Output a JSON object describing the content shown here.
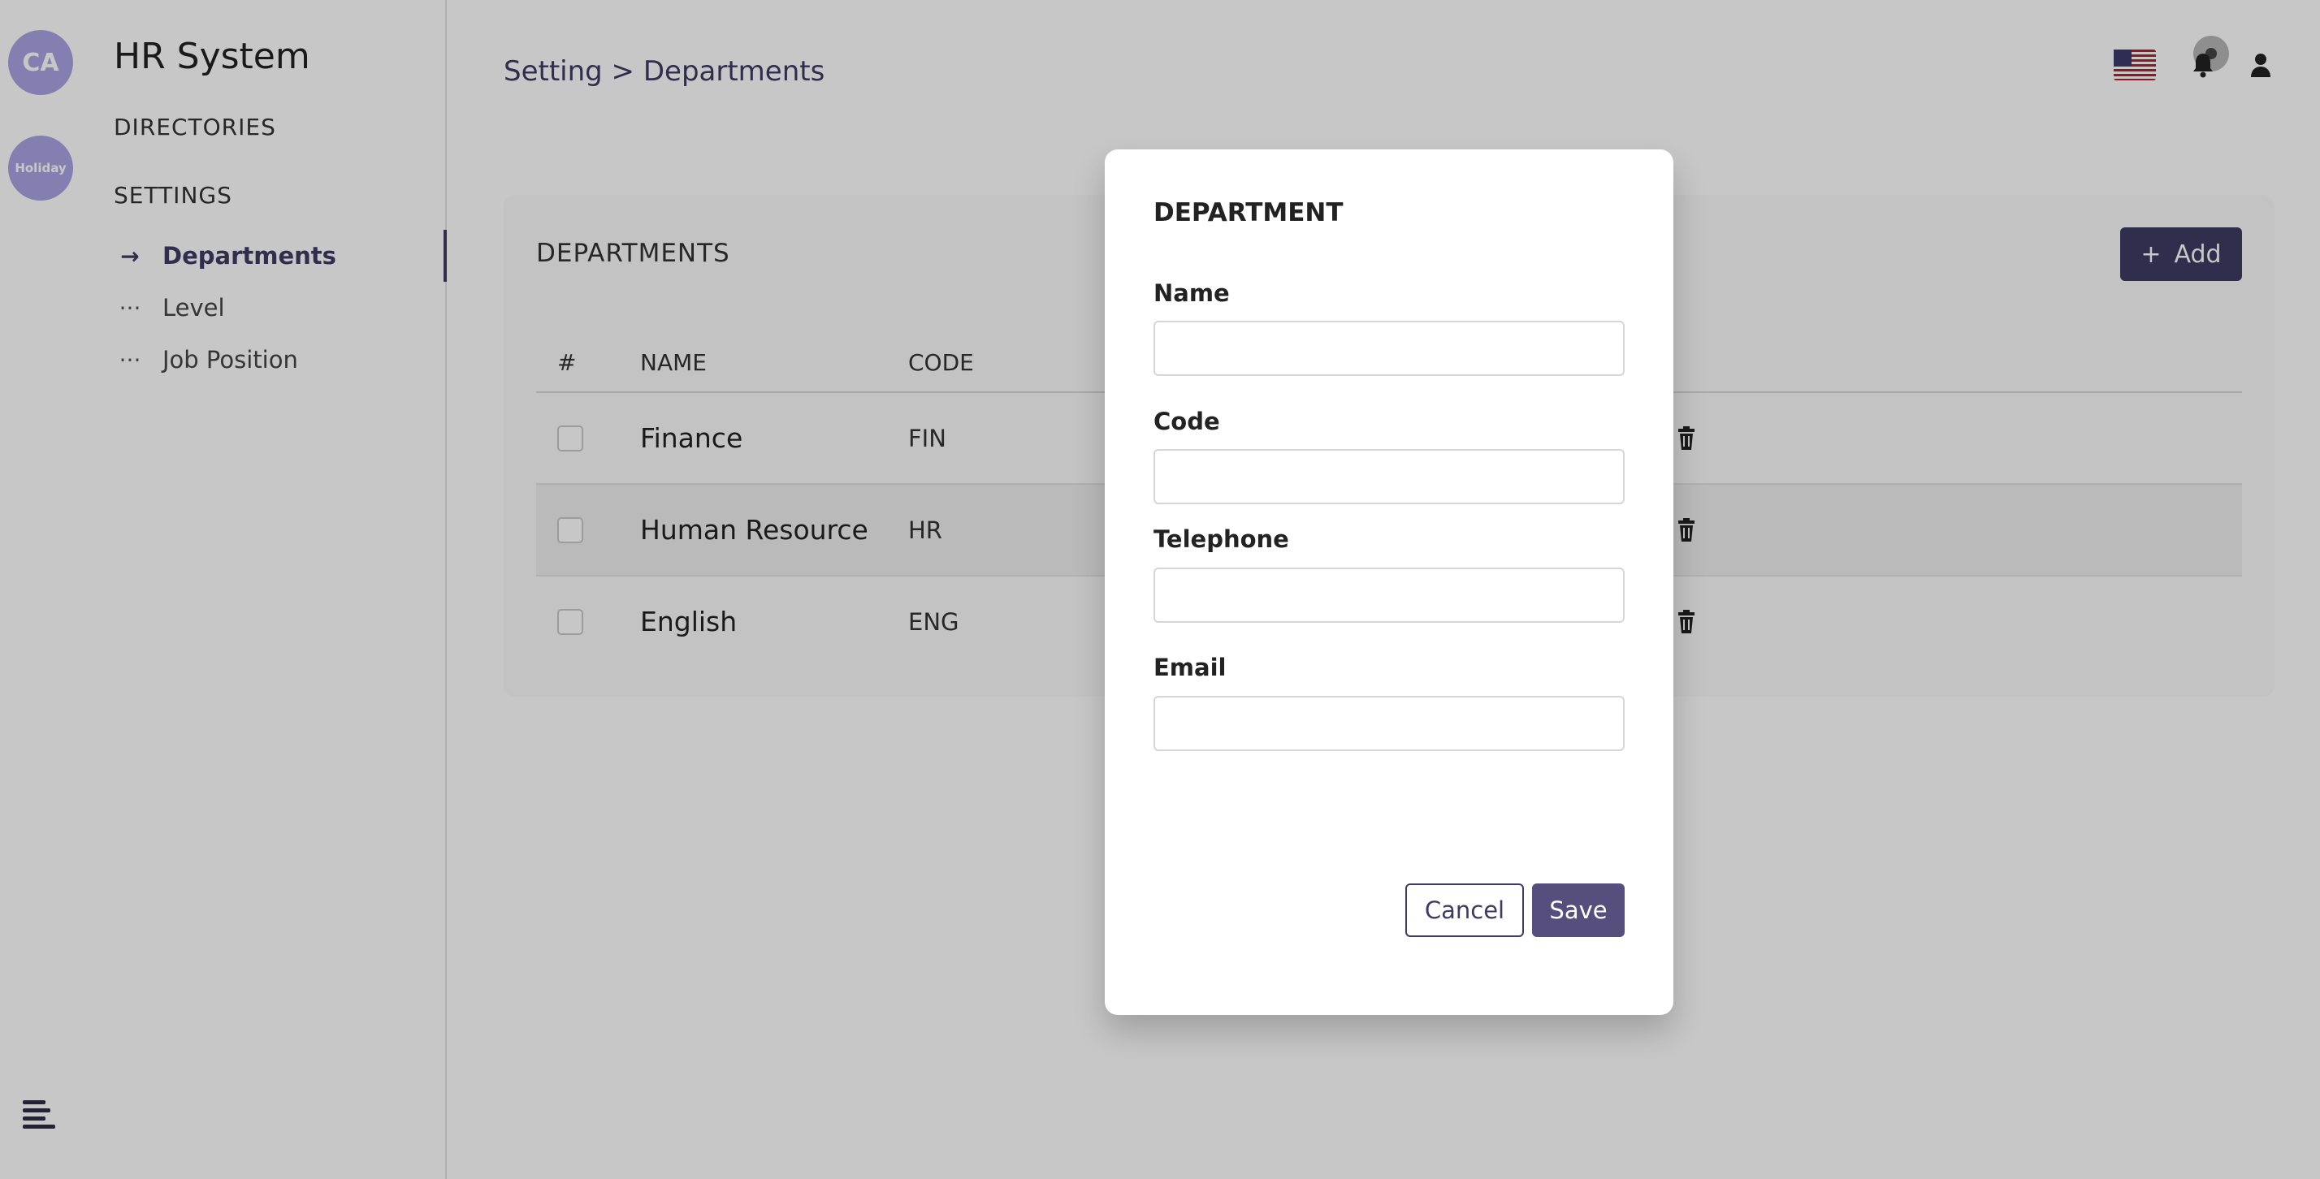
{
  "rail": {
    "avatar_initials": "CA",
    "holiday_label": "Holiday",
    "menu_icon": "hamburger-icon"
  },
  "sidebar": {
    "app_title": "HR System",
    "sections": [
      "DIRECTORIES",
      "SETTINGS"
    ],
    "settings_items": [
      {
        "label": "Departments",
        "icon": "arrow-right-icon",
        "active": true
      },
      {
        "label": "Level",
        "icon": "ellipsis-icon",
        "active": false
      },
      {
        "label": "Job Position",
        "icon": "ellipsis-icon",
        "active": false
      }
    ]
  },
  "header": {
    "breadcrumb": "Setting > Departments",
    "icons": [
      "us-flag-icon",
      "bell-icon",
      "user-icon"
    ]
  },
  "card": {
    "title": "DEPARTMENTS",
    "add_label": "Add",
    "columns": [
      "#",
      "NAME",
      "CODE"
    ],
    "rows": [
      {
        "name": "Finance",
        "code": "FIN"
      },
      {
        "name": "Human Resource",
        "code": "HR"
      },
      {
        "name": "English",
        "code": "ENG"
      }
    ]
  },
  "modal": {
    "title": "DEPARTMENT",
    "fields": [
      {
        "label": "Name",
        "value": "",
        "placeholder": ""
      },
      {
        "label": "Code",
        "value": "",
        "placeholder": ""
      },
      {
        "label": "Telephone",
        "value": "",
        "placeholder": ""
      },
      {
        "label": "Email",
        "value": "",
        "placeholder": ""
      }
    ],
    "cancel_label": "Cancel",
    "save_label": "Save"
  },
  "colors": {
    "accent": "#3e3a63",
    "avatar": "#a9a3e2",
    "save_button": "#564f7e"
  }
}
